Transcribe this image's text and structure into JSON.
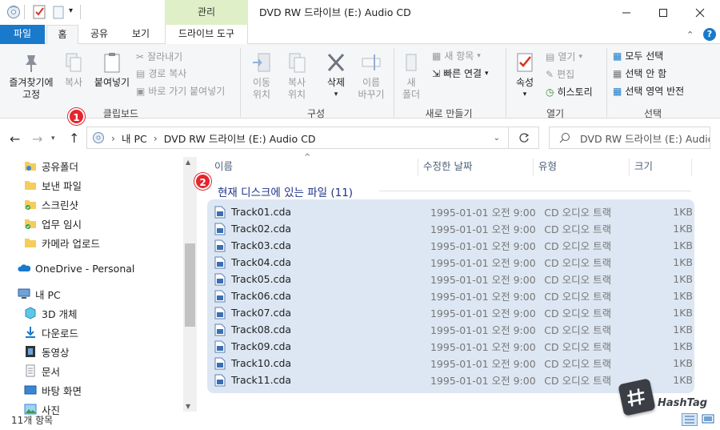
{
  "window": {
    "title": "DVD RW 드라이브 (E:) Audio CD",
    "manage_tab": "관리"
  },
  "ribbon_tabs": {
    "file": "파일",
    "home": "홈",
    "share": "공유",
    "view": "보기",
    "drive_tools": "드라이브 도구"
  },
  "ribbon": {
    "clipboard": {
      "pin": "즐겨찾기에\n고정",
      "copy": "복사",
      "paste": "붙여넣기",
      "cut": "잘라내기",
      "copy_path": "경로 복사",
      "paste_shortcut": "바로 가기 붙여넣기",
      "label": "클립보드"
    },
    "organize": {
      "move_to": "이동\n위치",
      "copy_to": "복사\n위치",
      "delete": "삭제",
      "rename": "이름\n바꾸기",
      "label": "구성"
    },
    "new": {
      "new_folder": "새\n폴더",
      "new_item": "새 항목",
      "easy_access": "빠른 연결",
      "label": "새로 만들기"
    },
    "open": {
      "properties": "속성",
      "open": "열기",
      "edit": "편집",
      "history": "히스토리",
      "label": "열기"
    },
    "select": {
      "select_all": "모두 선택",
      "select_none": "선택 안 함",
      "invert": "선택 영역 반전",
      "label": "선택"
    }
  },
  "address": {
    "crumbs": [
      "내 PC",
      "DVD RW 드라이브 (E:) Audio CD"
    ],
    "search_placeholder": "DVD RW 드라이브 (E:) Audio CD 검색"
  },
  "nav": [
    {
      "label": "공유폴더",
      "icon": "shared-folder-icon"
    },
    {
      "label": "보낸 파일",
      "icon": "folder-icon"
    },
    {
      "label": "스크린샷",
      "icon": "folder-check-icon"
    },
    {
      "label": "업무 임시",
      "icon": "folder-check-icon"
    },
    {
      "label": "카메라 업로드",
      "icon": "folder-icon"
    },
    {
      "label": "OneDrive - Personal",
      "icon": "cloud-icon"
    },
    {
      "label": "내 PC",
      "icon": "pc-icon"
    },
    {
      "label": "3D 개체",
      "icon": "3d-objects-icon"
    },
    {
      "label": "다운로드",
      "icon": "download-icon"
    },
    {
      "label": "동영상",
      "icon": "video-icon"
    },
    {
      "label": "문서",
      "icon": "document-icon"
    },
    {
      "label": "바탕 화면",
      "icon": "desktop-icon"
    },
    {
      "label": "사진",
      "icon": "pictures-icon"
    }
  ],
  "columns": {
    "name": "이름",
    "date": "수정한 날짜",
    "type": "유형",
    "size": "크기"
  },
  "group_header": "현재 디스크에 있는 파일 (11)",
  "files": [
    {
      "name": "Track01.cda",
      "date": "1995-01-01 오전 9:00",
      "type": "CD 오디오 트랙",
      "size": "1KB"
    },
    {
      "name": "Track02.cda",
      "date": "1995-01-01 오전 9:00",
      "type": "CD 오디오 트랙",
      "size": "1KB"
    },
    {
      "name": "Track03.cda",
      "date": "1995-01-01 오전 9:00",
      "type": "CD 오디오 트랙",
      "size": "1KB"
    },
    {
      "name": "Track04.cda",
      "date": "1995-01-01 오전 9:00",
      "type": "CD 오디오 트랙",
      "size": "1KB"
    },
    {
      "name": "Track05.cda",
      "date": "1995-01-01 오전 9:00",
      "type": "CD 오디오 트랙",
      "size": "1KB"
    },
    {
      "name": "Track06.cda",
      "date": "1995-01-01 오전 9:00",
      "type": "CD 오디오 트랙",
      "size": "1KB"
    },
    {
      "name": "Track07.cda",
      "date": "1995-01-01 오전 9:00",
      "type": "CD 오디오 트랙",
      "size": "1KB"
    },
    {
      "name": "Track08.cda",
      "date": "1995-01-01 오전 9:00",
      "type": "CD 오디오 트랙",
      "size": "1KB"
    },
    {
      "name": "Track09.cda",
      "date": "1995-01-01 오전 9:00",
      "type": "CD 오디오 트랙",
      "size": "1KB"
    },
    {
      "name": "Track10.cda",
      "date": "1995-01-01 오전 9:00",
      "type": "CD 오디오 트랙",
      "size": "1KB"
    },
    {
      "name": "Track11.cda",
      "date": "1995-01-01 오전 9:00",
      "type": "CD 오디오 트랙",
      "size": "1KB"
    }
  ],
  "status": "11개 항목",
  "annotations": [
    "1",
    "2"
  ],
  "watermark": "HashTag",
  "colors": {
    "accent": "#1979ca",
    "selection": "#dde7f3",
    "manage_tab": "#dff0c9",
    "badge": "#e3262f"
  }
}
